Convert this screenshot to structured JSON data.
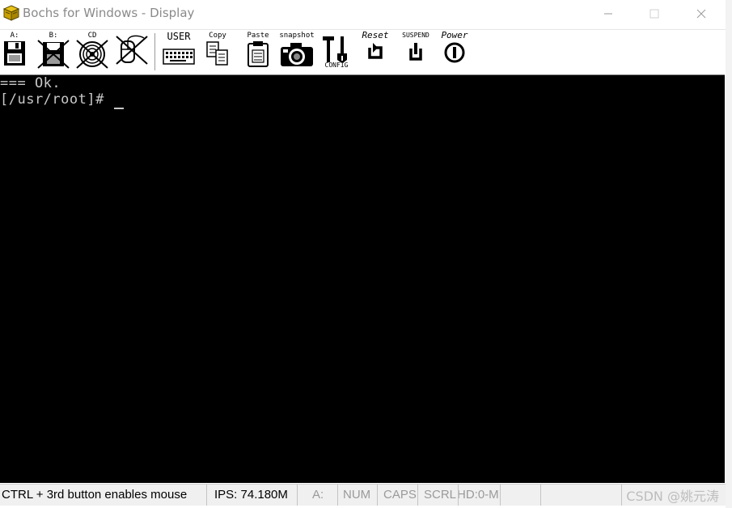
{
  "window": {
    "title": "Bochs for Windows - Display",
    "controls": {
      "minimize": "—",
      "maximize": "☐",
      "close": "✕"
    }
  },
  "toolbar": {
    "floppy_a": "A:",
    "floppy_b": "B:",
    "cdrom": "CD",
    "user": "USER",
    "copy": "Copy",
    "paste": "Paste",
    "snapshot": "snapshot",
    "config": "CONFIG",
    "reset": "Reset",
    "suspend": "SUSPEND",
    "power": "Power"
  },
  "terminal": {
    "lines": [
      "=== Ok.",
      "[/usr/root]# "
    ]
  },
  "status": {
    "mouse_hint": "CTRL + 3rd button enables mouse",
    "ips": "IPS: 74.180M",
    "drive": "A:",
    "num": "NUM",
    "caps": "CAPS",
    "scrl": "SCRL",
    "hd": "HD:0-M"
  },
  "watermark": "CSDN @姚元涛",
  "colors": {
    "terminal_bg": "#000000",
    "terminal_fg": "#c8c8c8",
    "status_bg": "#f0f0f0"
  }
}
